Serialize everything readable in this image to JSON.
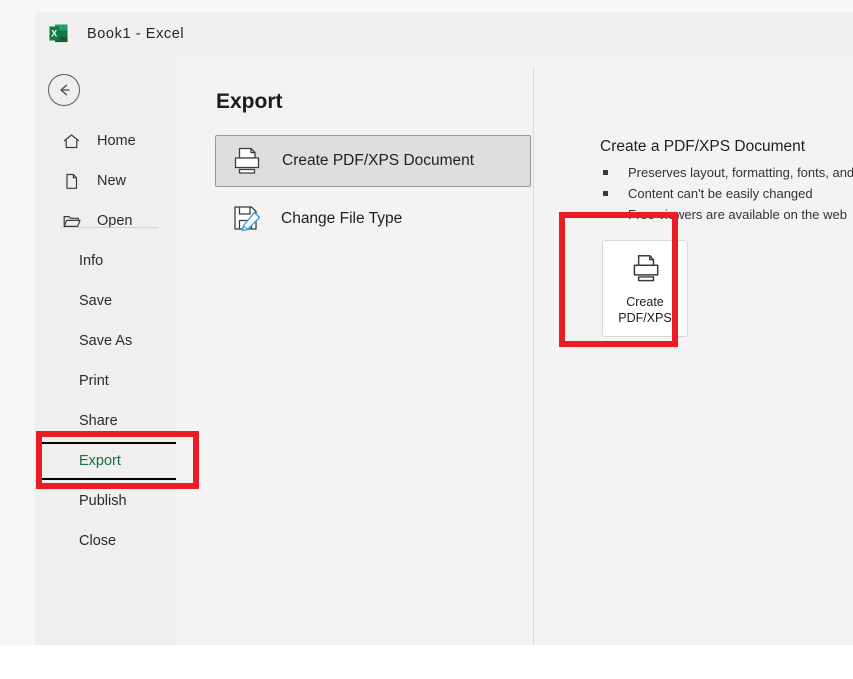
{
  "window": {
    "title": "Book1  -  Excel",
    "app_icon": "excel-logo-icon",
    "brand_green": "#107c41"
  },
  "sidebar": {
    "back_button": "back-arrow-icon",
    "top_items": [
      {
        "label": "Home",
        "icon": "home-icon"
      },
      {
        "label": "New",
        "icon": "new-document-icon"
      },
      {
        "label": "Open",
        "icon": "open-folder-icon"
      }
    ],
    "bottom_items": [
      {
        "label": "Info",
        "selected": false
      },
      {
        "label": "Save",
        "selected": false
      },
      {
        "label": "Save As",
        "selected": false
      },
      {
        "label": "Print",
        "selected": false
      },
      {
        "label": "Share",
        "selected": false
      },
      {
        "label": "Export",
        "selected": true
      },
      {
        "label": "Publish",
        "selected": false
      },
      {
        "label": "Close",
        "selected": false
      }
    ],
    "selected_color": "#14713b"
  },
  "main": {
    "page_title": "Export",
    "options": [
      {
        "label": "Create PDF/XPS Document",
        "icon": "publish-pdf-icon",
        "active": true
      },
      {
        "label": "Change File Type",
        "icon": "change-file-type-icon",
        "active": false
      }
    ]
  },
  "detail": {
    "title": "Create a PDF/XPS Document",
    "bullets": [
      "Preserves layout, formatting, fonts, and images",
      "Content can't be easily changed",
      "Free viewers are available on the web"
    ],
    "action_button": {
      "line1": "Create",
      "line2": "PDF/XPS",
      "icon": "publish-pdf-icon"
    }
  },
  "annotations": {
    "color": "#ec1c24",
    "boxes": [
      {
        "target": "sidebar-item-export"
      },
      {
        "target": "create-pdf-xps-button"
      }
    ]
  }
}
